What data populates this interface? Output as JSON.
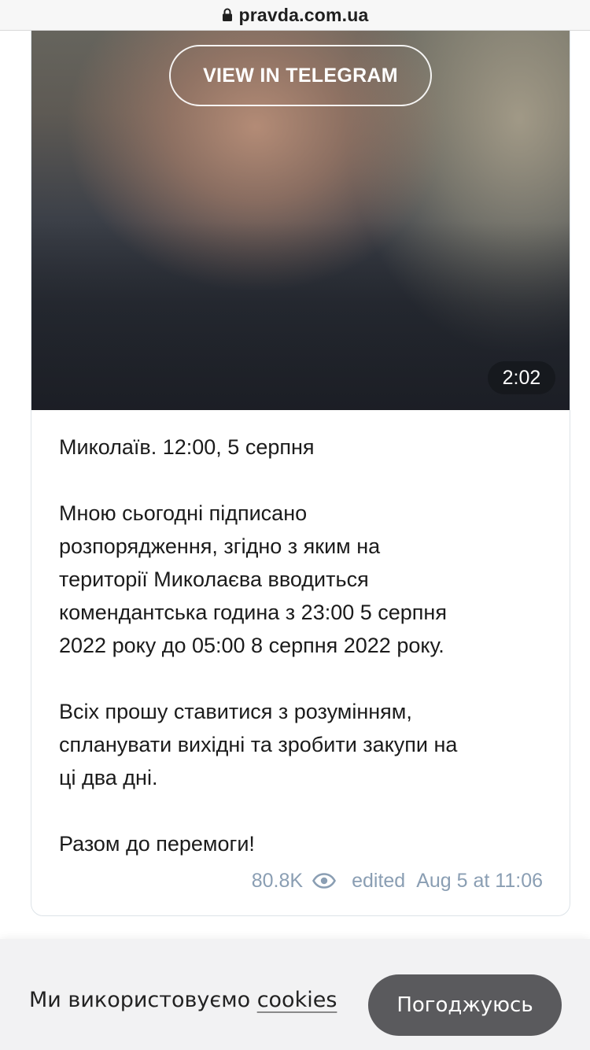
{
  "browser": {
    "host": "pravda.com.ua",
    "lock_icon": "lock-icon"
  },
  "post": {
    "view_button_label": "VIEW IN TELEGRAM",
    "video_duration": "2:02",
    "paragraphs": [
      "Миколаїв. 12:00, 5 серпня",
      "Мною сьогодні підписано\nрозпорядження, згідно з яким на\nтериторії Миколаєва вводиться\nкомендантська година з 23:00 5 серпня\n2022 року до 05:00 8 серпня 2022 року.",
      "Всіх прошу ставитися з розумінням,\nспланувати вихідні та зробити закупи на\nці два дні.",
      "Разом до перемоги!"
    ],
    "views": "80.8K",
    "views_icon": "eye-icon",
    "edited_label": "edited",
    "timestamp": "Aug 5 at 11:06"
  },
  "cookie_bar": {
    "message": "Ми використовуємо",
    "link_label": "cookies",
    "accept_label": "Погоджуюсь"
  }
}
